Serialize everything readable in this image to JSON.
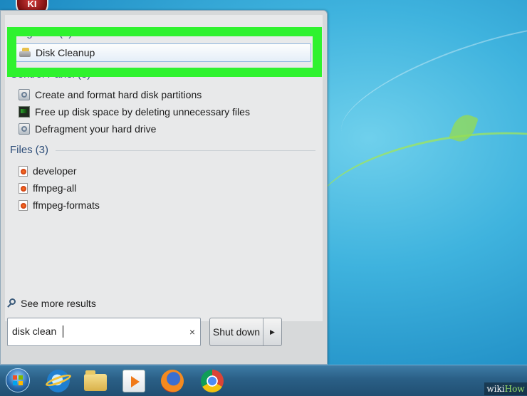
{
  "start_menu": {
    "groups": [
      {
        "title": "Programs",
        "count": "(1)",
        "items": [
          {
            "label": "Disk Cleanup",
            "icon": "disk-cleanup-icon",
            "selected": true
          }
        ]
      },
      {
        "title": "Control Panel",
        "count": "(3)",
        "items": [
          {
            "label": "Create and format hard disk partitions",
            "icon": "admin-tools-icon"
          },
          {
            "label": "Free up disk space by deleting unnecessary files",
            "icon": "performance-monitor-icon"
          },
          {
            "label": "Defragment your hard drive",
            "icon": "admin-tools-icon"
          }
        ]
      },
      {
        "title": "Files",
        "count": "(3)",
        "items": [
          {
            "label": "developer",
            "icon": "html-file-icon"
          },
          {
            "label": "ffmpeg-all",
            "icon": "html-file-icon"
          },
          {
            "label": "ffmpeg-formats",
            "icon": "html-file-icon"
          }
        ]
      }
    ],
    "see_more": "See more results",
    "search": {
      "value": "disk clean",
      "clear": "×"
    },
    "shutdown": {
      "label": "Shut down",
      "arrow": "▶"
    }
  },
  "taskbar": {
    "items": [
      "start-orb",
      "internet-explorer",
      "windows-explorer",
      "windows-media-player",
      "firefox",
      "chrome"
    ]
  },
  "watermark": {
    "part1": "wiki",
    "part2": "How"
  },
  "colors": {
    "highlight": "#2ff22f",
    "desktop": "#3fb3de",
    "group_header": "#2f4f7a"
  }
}
